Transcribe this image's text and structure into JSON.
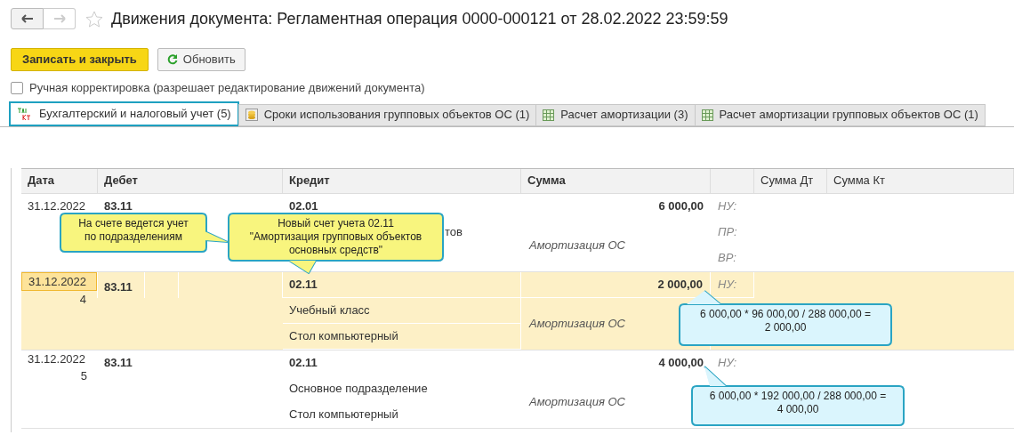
{
  "window": {
    "title": "Движения документа: Регламентная операция 0000-000121 от 28.02.2022 23:59:59",
    "favorite": false
  },
  "toolbar": {
    "primary_button": "Записать и закрыть",
    "refresh_button": "Обновить"
  },
  "manual_edit": {
    "label": "Ручная корректировка (разрешает редактирование движений документа)",
    "checked": false
  },
  "tabs": [
    {
      "label": "Бухгалтерский и налоговый учет (5)",
      "kind": "ledger",
      "selected": true
    },
    {
      "label": "Сроки использования групповых объектов ОС (1)",
      "kind": "coins",
      "selected": false
    },
    {
      "label": "Расчет амортизации (3)",
      "kind": "table",
      "selected": false
    },
    {
      "label": "Расчет амортизации групповых объектов ОС (1)",
      "kind": "table",
      "selected": false
    }
  ],
  "table": {
    "columns": [
      "Дата",
      "Дебет",
      "Кредит",
      "Сумма",
      "Сумма Дт",
      "Сумма Кт"
    ],
    "rows": [
      {
        "selected": false,
        "date": "31.12.2022",
        "debit": "83.11",
        "credit": [
          "02.01",
          "тов"
        ],
        "amount": "6 000,00",
        "content": "Амортизация ОС",
        "labels": [
          "НУ:",
          "ПР:",
          "ВР:"
        ]
      },
      {
        "selected": true,
        "date": "31.12.2022",
        "number": "4",
        "debit": "83.11",
        "credit": [
          "02.11",
          "Учебный класс",
          "Стол компьютерный"
        ],
        "amount": "2 000,00",
        "content": "Амортизация ОС",
        "labels": [
          "НУ:"
        ]
      },
      {
        "selected": false,
        "date": "31.12.2022",
        "number": "5",
        "debit": "83.11",
        "credit": [
          "02.11",
          "Основное подразделение",
          "Стол компьютерный"
        ],
        "amount": "4 000,00",
        "content": "Амортизация ОС",
        "labels": [
          "НУ:"
        ]
      }
    ]
  },
  "callouts": [
    {
      "kind": "yellow",
      "lines": [
        "На счете ведется учет",
        "по подразделениям"
      ]
    },
    {
      "kind": "yellow",
      "lines": [
        "Новый счет учета 02.11",
        "\"Амортизация групповых объектов",
        "основных средств\""
      ]
    },
    {
      "kind": "blue",
      "lines": [
        "6 000,00 * 96 000,00 / 288 000,00 =",
        "2 000,00"
      ]
    },
    {
      "kind": "blue",
      "lines": [
        "6 000,00 * 192 000,00 / 288 000,00 =",
        "4 000,00"
      ]
    }
  ]
}
